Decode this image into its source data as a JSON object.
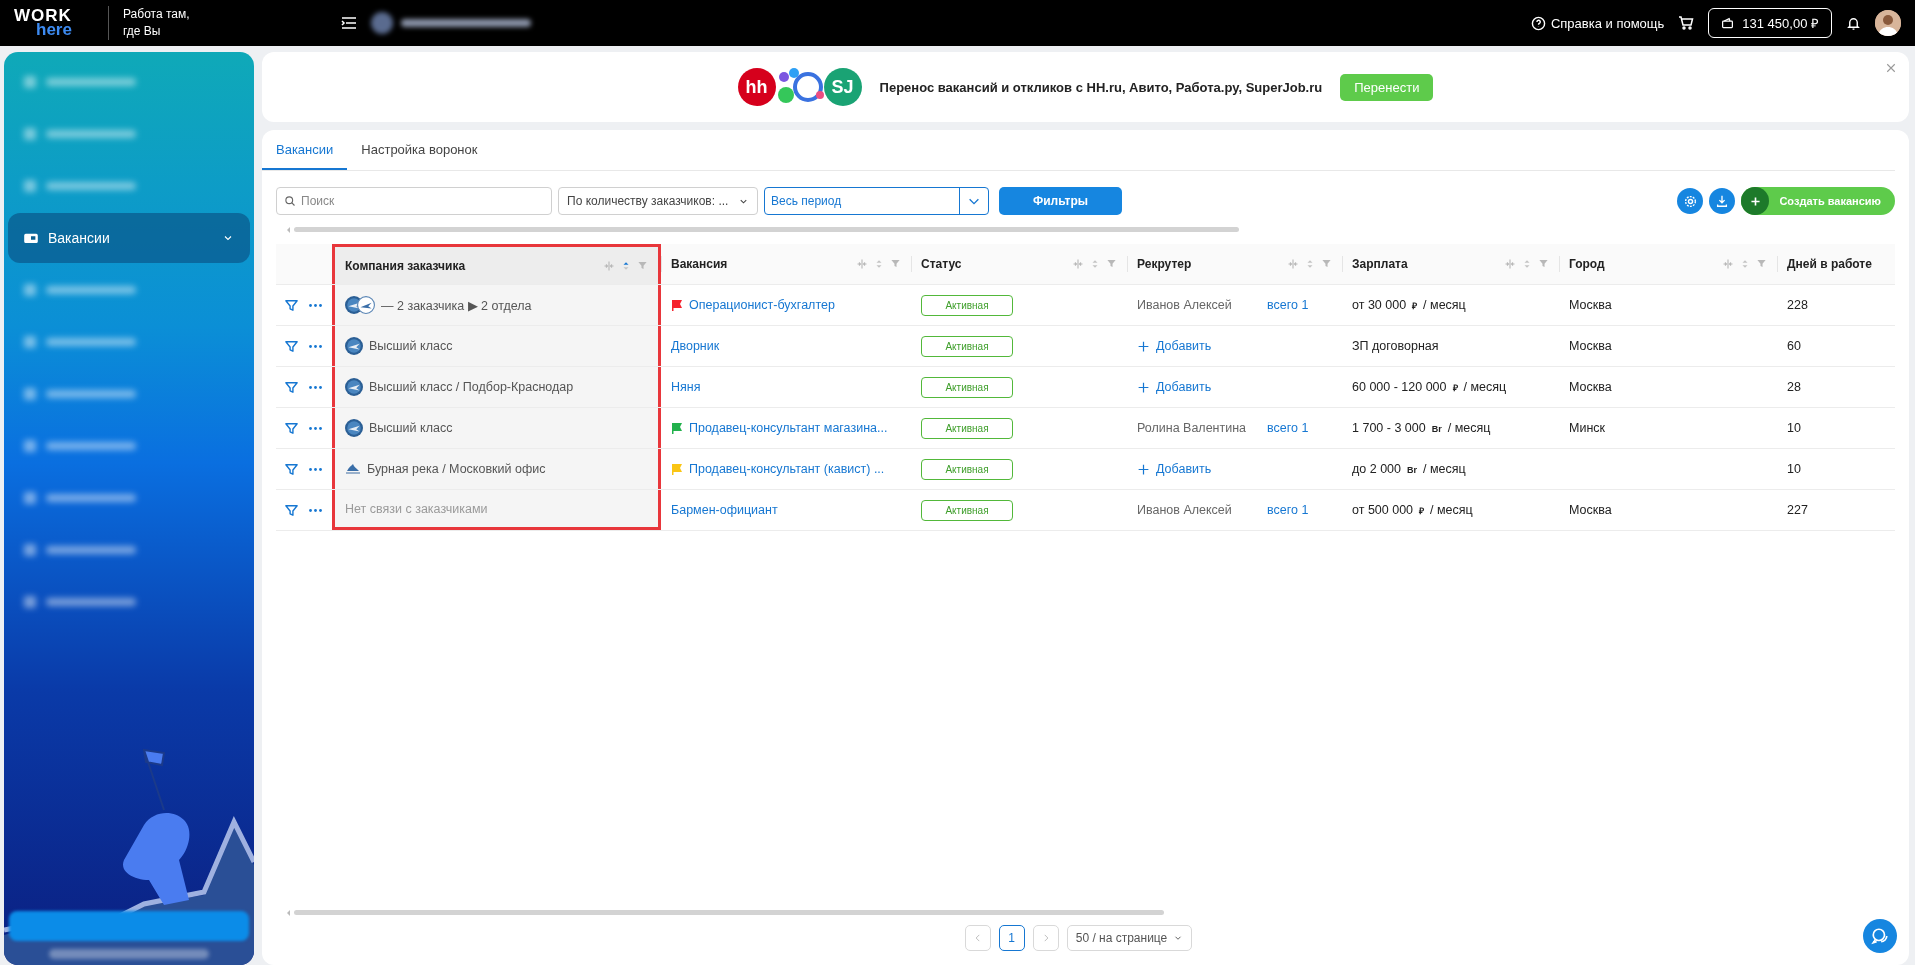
{
  "header": {
    "logo": {
      "word": "WORK",
      "sub": "here"
    },
    "slogan": [
      "Работа там,",
      "где Вы"
    ],
    "help": "Справка и помощь",
    "balance": "131 450,00 ₽"
  },
  "banner": {
    "logos": [
      "hh",
      "SJ"
    ],
    "text": "Перенос вакансий и откликов с HH.ru, Авито, Работа.ру, SuperJob.ru",
    "button": "Перенести"
  },
  "sidebar": {
    "items": [
      {
        "kind": "blurred",
        "selected": false
      },
      {
        "kind": "blurred",
        "selected": false
      },
      {
        "kind": "blurred",
        "selected": false
      },
      {
        "kind": "item",
        "label": "Вакансии",
        "selected": true
      },
      {
        "kind": "blurred",
        "selected": false
      },
      {
        "kind": "blurred",
        "selected": false
      },
      {
        "kind": "blurred",
        "selected": false
      },
      {
        "kind": "blurred",
        "selected": false
      },
      {
        "kind": "blurred",
        "selected": false
      },
      {
        "kind": "blurred",
        "selected": false
      },
      {
        "kind": "blurred",
        "selected": false
      }
    ]
  },
  "tabs": [
    {
      "label": "Вакансии",
      "selected": true
    },
    {
      "label": "Настройка воронок",
      "selected": false
    }
  ],
  "toolbar": {
    "search": {
      "placeholder": "Поиск"
    },
    "sort_select": "По количеству заказчиков: ...",
    "period": "Весь период",
    "filters_button": "Фильтры",
    "create_button": "Создать вакансию"
  },
  "table": {
    "columns": [
      {
        "label": "Компания заказчика",
        "highlighted": true,
        "sorted": true,
        "controls": true
      },
      {
        "label": "Вакансия",
        "highlighted": false,
        "sorted": false,
        "controls": true
      },
      {
        "label": "Статус",
        "highlighted": false,
        "sorted": false,
        "controls": true
      },
      {
        "label": "Рекрутер",
        "highlighted": false,
        "sorted": false,
        "controls": true
      },
      {
        "label": "Зарплата",
        "highlighted": false,
        "sorted": false,
        "controls": true
      },
      {
        "label": "Город",
        "highlighted": false,
        "sorted": false,
        "controls": true
      },
      {
        "label": "Дней в работе",
        "highlighted": false,
        "sorted": false,
        "controls": false
      }
    ],
    "rows": [
      {
        "company": {
          "kind": "group",
          "text": "— 2 заказчика ▶ 2 отдела"
        },
        "vacancy": {
          "title": "Операционист-бухгалтер",
          "color": "#f5222d"
        },
        "status": "Активная",
        "recruiter": {
          "kind": "assigned",
          "name": "Иванов Алексей",
          "count": "всего 1"
        },
        "salary": {
          "amount": "от 30 000",
          "currency": "₽",
          "period": "/ месяц"
        },
        "city": "Москва",
        "days": "228"
      },
      {
        "company": {
          "kind": "company",
          "text": "Высший класс"
        },
        "vacancy": {
          "title": "Дворник"
        },
        "status": "Активная",
        "recruiter": {
          "kind": "add",
          "label": "Добавить"
        },
        "salary": {
          "amount": "ЗП договорная"
        },
        "city": "Москва",
        "days": "60"
      },
      {
        "company": {
          "kind": "company",
          "text": "Высший класс / Подбор-Краснодар"
        },
        "vacancy": {
          "title": "Няня"
        },
        "status": "Активная",
        "recruiter": {
          "kind": "add",
          "label": "Добавить"
        },
        "salary": {
          "amount": "60 000 - 120 000",
          "currency": "₽",
          "period": "/ месяц"
        },
        "city": "Москва",
        "days": "28"
      },
      {
        "company": {
          "kind": "company",
          "text": "Высший класс"
        },
        "vacancy": {
          "title": "Продавец-консультант магазина...",
          "color": "#22b14c"
        },
        "status": "Активная",
        "recruiter": {
          "kind": "assigned",
          "name": "Ролина Валентина",
          "count": "всего 1"
        },
        "salary": {
          "amount": "1 700 - 3 000",
          "currency": "Br",
          "period": "/ месяц"
        },
        "city": "Минск",
        "days": "10"
      },
      {
        "company": {
          "kind": "small",
          "text": "Бурная река / Московкий офис"
        },
        "vacancy": {
          "title": "Продавец-консультант (кавист) ...",
          "color": "#fac514"
        },
        "status": "Активная",
        "recruiter": {
          "kind": "add",
          "label": "Добавить"
        },
        "salary": {
          "amount": "до 2 000",
          "currency": "Br",
          "period": "/ месяц"
        },
        "days": "10"
      },
      {
        "company": {
          "kind": "none",
          "text": "Нет связи с заказчиками"
        },
        "vacancy": {
          "title": "Бармен-официант"
        },
        "status": "Активная",
        "recruiter": {
          "kind": "assigned",
          "name": "Иванов Алексей",
          "count": "всего 1"
        },
        "salary": {
          "amount": "от 500 000",
          "currency": "₽",
          "period": "/ месяц"
        },
        "city": "Москва",
        "days": "227"
      }
    ]
  },
  "pagination": {
    "pages": [
      {
        "label": "1",
        "selected": true
      }
    ],
    "page_size": "50 / на странице"
  }
}
